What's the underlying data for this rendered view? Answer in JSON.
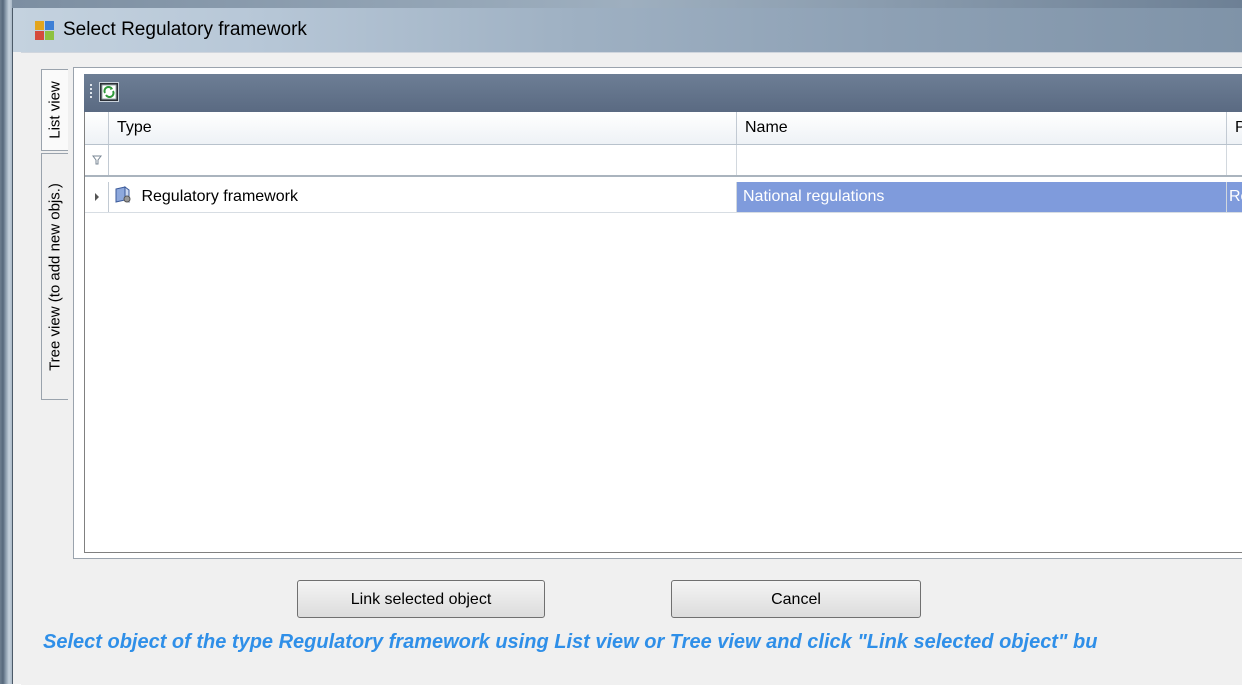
{
  "window": {
    "title": "Select Regulatory framework"
  },
  "tabs": [
    {
      "label": "List view",
      "active": true
    },
    {
      "label": "Tree view (to add new objs.)",
      "active": false
    }
  ],
  "toolbar": {
    "refresh_icon": "refresh-icon"
  },
  "grid": {
    "columns": [
      "Type",
      "Name",
      "Pa"
    ],
    "rows": [
      {
        "type": "Regulatory framework",
        "name": "National regulations",
        "col3": "Re",
        "icon": "regulatory-framework-icon",
        "selected": true
      }
    ]
  },
  "buttons": {
    "link_label": "Link selected object",
    "cancel_label": "Cancel"
  },
  "hint": {
    "text": "Select object of the type Regulatory framework using List view or Tree view and click \"Link selected object\" bu"
  },
  "colors": {
    "selection": "#7f9bdc",
    "hint": "#2f8fe8",
    "toolbar": "#5a6a82"
  }
}
